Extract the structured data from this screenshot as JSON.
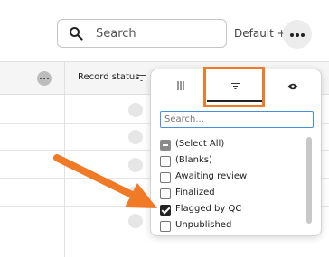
{
  "toolbar": {
    "search_placeholder": "Search",
    "view_label": "Default +",
    "icons": {
      "search": "search-icon",
      "more": "more-horizontal-icon"
    }
  },
  "grid": {
    "columns": [
      {
        "title": ""
      },
      {
        "title": "Record status",
        "icon": "filter-icon"
      }
    ],
    "row_count_visible": 5
  },
  "filter_popup": {
    "tabs": [
      {
        "name": "columns",
        "icon": "columns-icon",
        "active": false
      },
      {
        "name": "filter",
        "icon": "filter-icon",
        "active": true
      },
      {
        "name": "visibility",
        "icon": "eye-icon",
        "active": false
      }
    ],
    "search_placeholder": "Search...",
    "options": [
      {
        "label": "(Select All)",
        "state": "indeterminate"
      },
      {
        "label": "(Blanks)",
        "state": "unchecked"
      },
      {
        "label": "Awaiting review",
        "state": "unchecked"
      },
      {
        "label": "Finalized",
        "state": "unchecked"
      },
      {
        "label": "Flagged by QC",
        "state": "checked"
      },
      {
        "label": "Unpublished",
        "state": "unchecked"
      }
    ]
  },
  "colors": {
    "highlight": "#f07a26",
    "input_focus": "#4a90d9",
    "header_bg": "#f5f5f5"
  }
}
